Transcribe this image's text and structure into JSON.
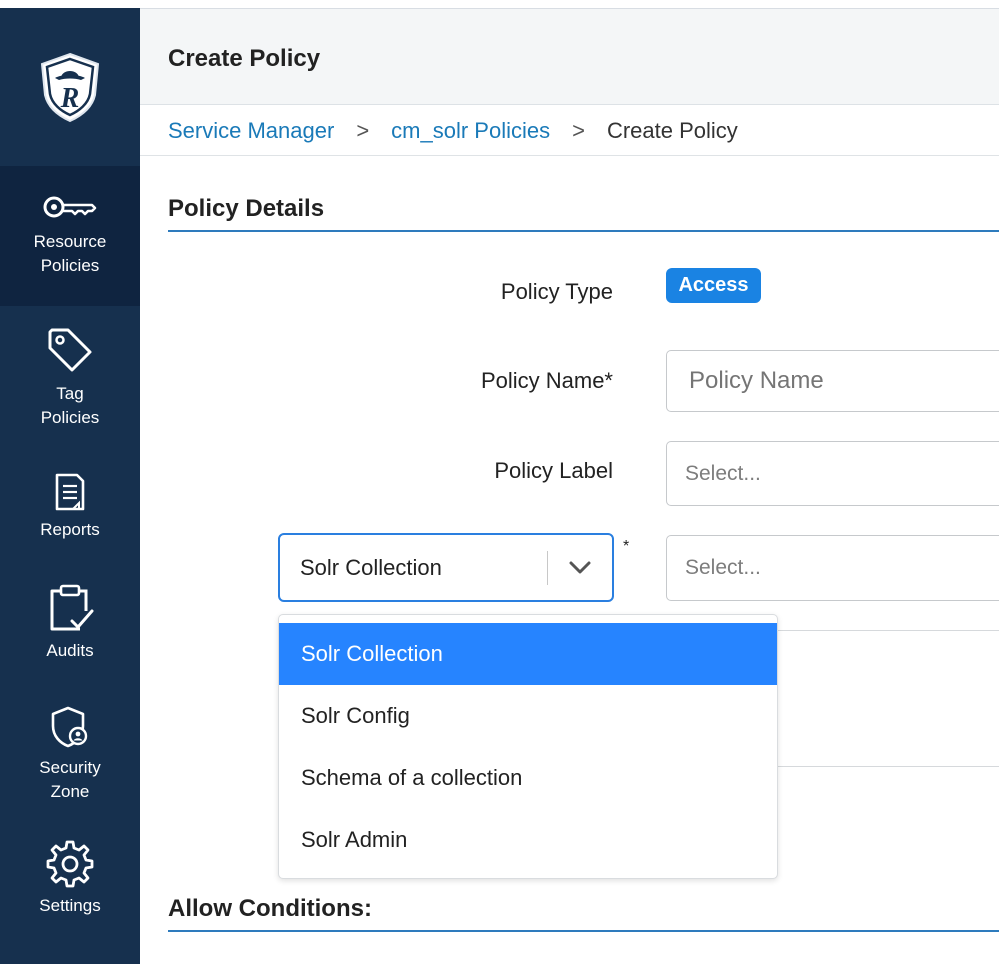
{
  "header": {
    "title": "Create Policy"
  },
  "breadcrumb": {
    "items": [
      "Service Manager",
      "cm_solr Policies",
      "Create Policy"
    ],
    "separator": ">"
  },
  "sidebar": {
    "logo_letter": "R",
    "items": [
      {
        "line1": "Resource",
        "line2": "Policies",
        "icon": "key-icon",
        "active": true
      },
      {
        "line1": "Tag",
        "line2": "Policies",
        "icon": "tag-icon"
      },
      {
        "line1": "Reports",
        "line2": "",
        "icon": "report-icon"
      },
      {
        "line1": "Audits",
        "line2": "",
        "icon": "clipboard-check-icon"
      },
      {
        "line1": "Security",
        "line2": "Zone",
        "icon": "shield-user-icon"
      },
      {
        "line1": "Settings",
        "line2": "",
        "icon": "gear-icon"
      }
    ]
  },
  "policy_details": {
    "title": "Policy Details",
    "policy_type_label": "Policy Type",
    "policy_type_value": "Access",
    "policy_name_label": "Policy Name*",
    "policy_name_placeholder": "Policy Name",
    "policy_label_label": "Policy Label",
    "policy_label_placeholder": "Select...",
    "resource_type_selected": "Solr Collection",
    "resource_required_mark": "*",
    "resource_value_placeholder": "Select..."
  },
  "resource_dropdown": {
    "options": [
      "Solr Collection",
      "Solr Config",
      "Schema of a collection",
      "Solr Admin"
    ],
    "selected_index": 0
  },
  "allow_conditions": {
    "title": "Allow Conditions:"
  },
  "colors": {
    "sidebar": "#16304e",
    "accent": "#2e7bbd",
    "badge": "#1a83e3",
    "option_selected": "#2684ff",
    "link": "#1a7ab8"
  }
}
